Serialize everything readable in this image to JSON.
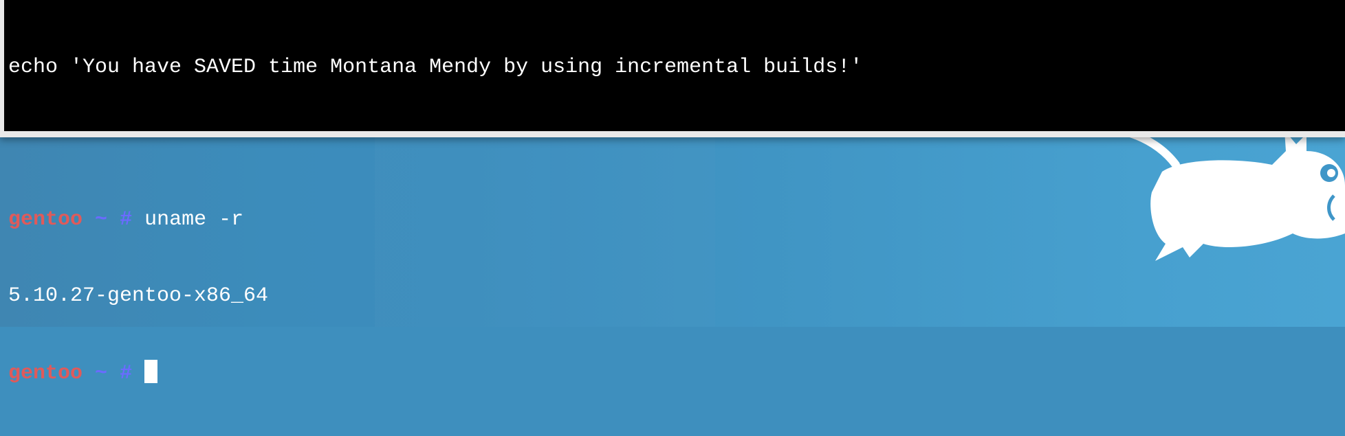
{
  "terminal": {
    "lines": [
      {
        "text": "echo 'You have SAVED time Montana Mendy by using incremental builds!'"
      },
      {
        "text": ""
      },
      {
        "host": "gentoo",
        "dir": "~",
        "symbol": "#",
        "command": " uname -r"
      },
      {
        "text": "5.10.27-gentoo-x86_64"
      },
      {
        "host": "gentoo",
        "dir": "~",
        "symbol": "#",
        "command": " "
      }
    ]
  },
  "desktop": {
    "wallpaper_mascot": "rat-mascot-icon"
  },
  "colors": {
    "terminal_bg": "#000000",
    "terminal_fg": "#ffffff",
    "prompt_host": "#e05a5a",
    "prompt_symbol": "#6b6bff",
    "desktop_bg": "#3e8fbe"
  }
}
